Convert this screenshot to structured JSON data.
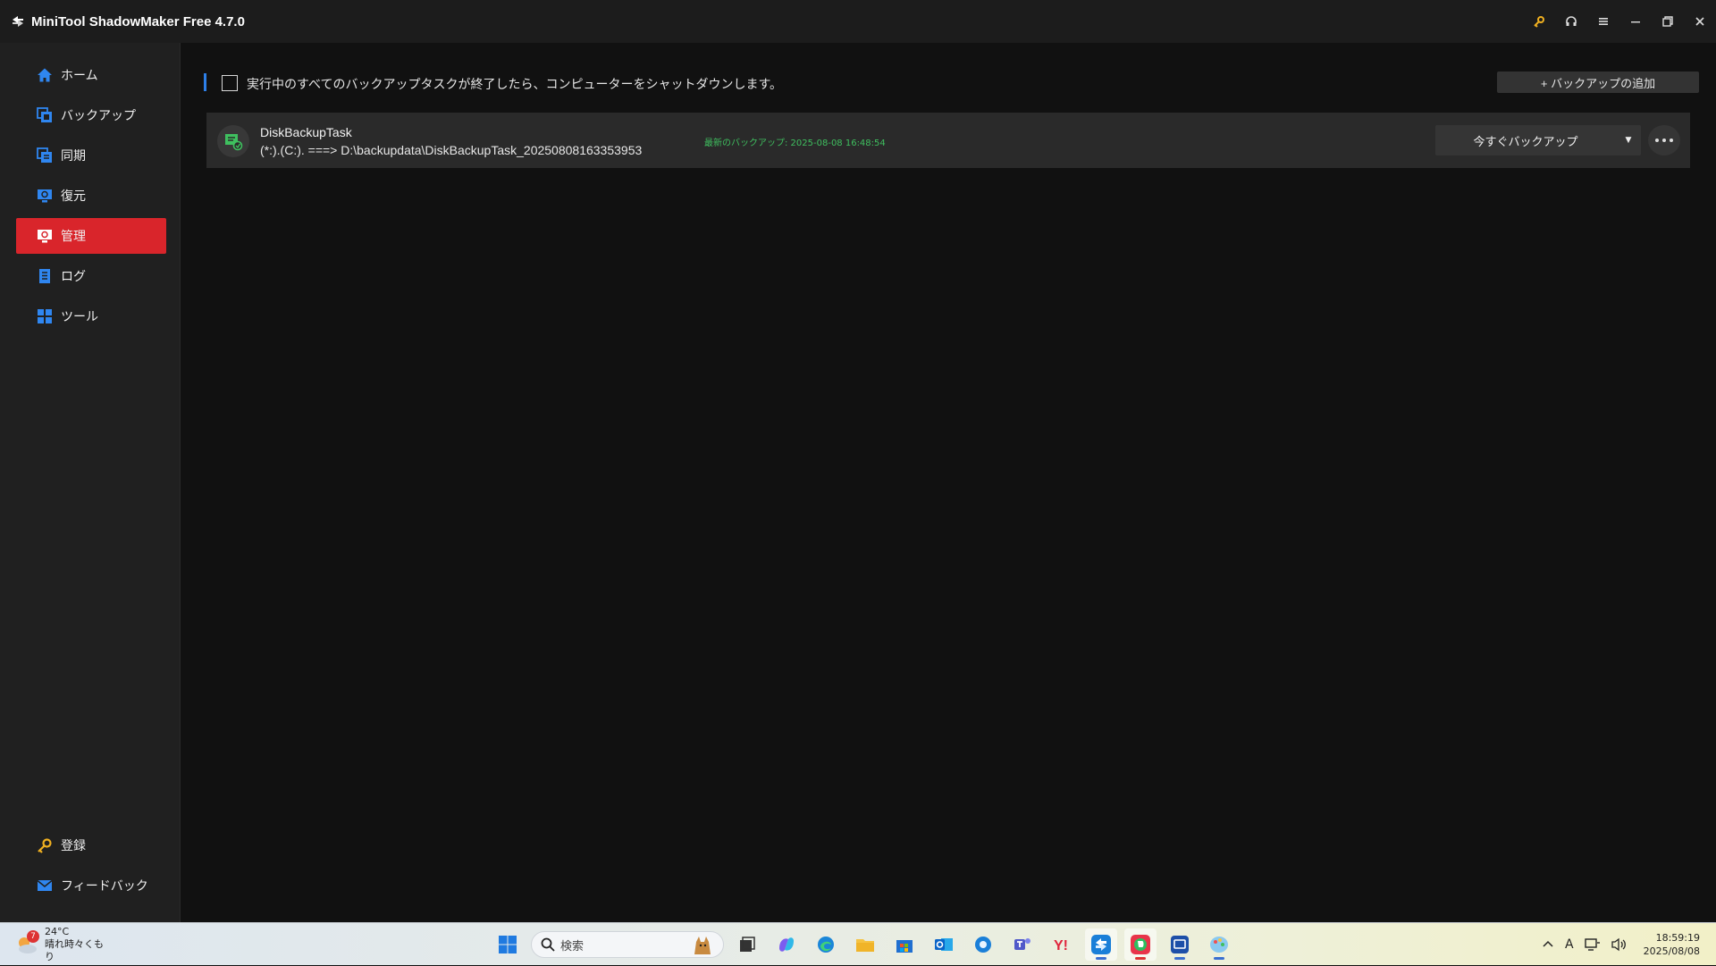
{
  "window": {
    "title": "MiniTool ShadowMaker Free 4.7.0",
    "accent": "#d9252b"
  },
  "sidebar": {
    "items": [
      {
        "label": "ホーム",
        "icon": "home-icon"
      },
      {
        "label": "バックアップ",
        "icon": "backup-icon"
      },
      {
        "label": "同期",
        "icon": "sync-icon"
      },
      {
        "label": "復元",
        "icon": "restore-icon"
      },
      {
        "label": "管理",
        "icon": "manage-icon",
        "active": true
      },
      {
        "label": "ログ",
        "icon": "log-icon"
      },
      {
        "label": "ツール",
        "icon": "tools-icon"
      }
    ],
    "bottom": [
      {
        "label": "登録",
        "icon": "key-icon"
      },
      {
        "label": "フィードバック",
        "icon": "mail-icon"
      }
    ]
  },
  "main": {
    "shutdown_label": "実行中のすべてのバックアップタスクが終了したら、コンピューターをシャットダウンします。",
    "add_backup_label": "+ バックアップの追加",
    "task": {
      "name": "DiskBackupTask",
      "path": "(*:).(C:). ===> D:\\backupdata\\DiskBackupTask_20250808163353953",
      "last_backup": "最新のバックアップ: 2025-08-08 16:48:54",
      "backup_now_label": "今すぐバックアップ"
    }
  },
  "taskbar": {
    "weather": {
      "temp": "24°C",
      "desc": "晴れ時々くもり",
      "badge": "7"
    },
    "search_label": "検索",
    "clock": {
      "time": "18:59:19",
      "date": "2025/08/08"
    },
    "ime": "A"
  }
}
